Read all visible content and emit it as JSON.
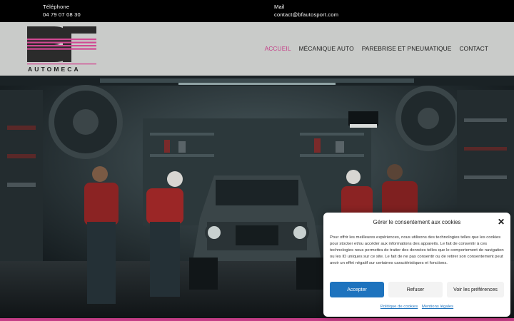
{
  "topbar": {
    "phone_label": "Téléphone",
    "phone_value": "04 79 07 08 30",
    "mail_label": "Mail",
    "mail_value": "contact@bfautosport.com"
  },
  "header": {
    "logo_text": "AUTOMECA",
    "nav": [
      {
        "label": "ACCUEIL",
        "active": true
      },
      {
        "label": "MÉCANIQUE AUTO",
        "active": false
      },
      {
        "label": "PAREBRISE ET PNEUMATIQUE",
        "active": false
      },
      {
        "label": "CONTACT",
        "active": false
      }
    ]
  },
  "cookie": {
    "title": "Gérer le consentement aux cookies",
    "text": "Pour offrir les meilleures expériences, nous utilisons des technologies telles que les cookies pour stocker et/ou accéder aux informations des appareils. Le fait de consentir à ces technologies nous permettra de traiter des données telles que le comportement de navigation ou les ID uniques sur ce site. Le fait de ne pas consentir ou de retirer son consentement peut avoir un effet négatif sur certaines caractéristiques et fonctions.",
    "accept_label": "Accepter",
    "refuse_label": "Refuser",
    "prefs_label": "Voir les préférences",
    "policy_link": "Politique de cookies",
    "legal_link": "Mentions légales"
  },
  "colors": {
    "accent": "#c43d86",
    "button_primary": "#1e73be",
    "header_bg": "#c9cbc9",
    "topbar_bg": "#000000"
  }
}
